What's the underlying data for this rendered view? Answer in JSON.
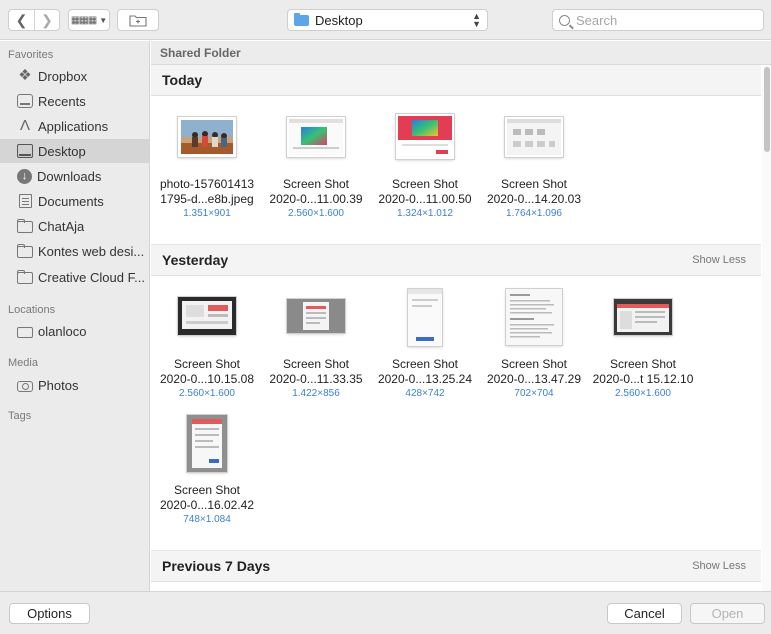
{
  "toolbar": {
    "back_icon": "chevron-left",
    "forward_icon": "chevron-right",
    "view_icon": "icon-grid",
    "location": "Desktop",
    "search_placeholder": "Search"
  },
  "sidebar": {
    "favorites_label": "Favorites",
    "favorites": [
      {
        "label": "Dropbox",
        "icon": "dropbox-icon"
      },
      {
        "label": "Recents",
        "icon": "recents-icon"
      },
      {
        "label": "Applications",
        "icon": "applications-icon"
      },
      {
        "label": "Desktop",
        "icon": "desktop-icon",
        "selected": true
      },
      {
        "label": "Downloads",
        "icon": "downloads-icon"
      },
      {
        "label": "Documents",
        "icon": "documents-icon"
      },
      {
        "label": "ChatAja",
        "icon": "folder-icon"
      },
      {
        "label": "Kontes web desi...",
        "icon": "folder-icon"
      },
      {
        "label": "Creative Cloud F...",
        "icon": "folder-icon"
      }
    ],
    "locations_label": "Locations",
    "locations": [
      {
        "label": "olanloco",
        "icon": "disk-icon"
      }
    ],
    "media_label": "Media",
    "media": [
      {
        "label": "Photos",
        "icon": "camera-icon"
      }
    ],
    "tags_label": "Tags"
  },
  "main": {
    "path_label": "Shared Folder",
    "groups": [
      {
        "title": "Today",
        "toggle": "",
        "files": [
          {
            "name1": "photo-157601413",
            "name2": "1795-d...e8b.jpeg",
            "dims": "1.351×901"
          },
          {
            "name1": "Screen Shot",
            "name2": "2020-0...11.00.39",
            "dims": "2.560×1.600"
          },
          {
            "name1": "Screen Shot",
            "name2": "2020-0...11.00.50",
            "dims": "1.324×1.012"
          },
          {
            "name1": "Screen Shot",
            "name2": "2020-0...14.20.03",
            "dims": "1.764×1.096"
          }
        ]
      },
      {
        "title": "Yesterday",
        "toggle": "Show Less",
        "files": [
          {
            "name1": "Screen Shot",
            "name2": "2020-0...10.15.08",
            "dims": "2.560×1.600"
          },
          {
            "name1": "Screen Shot",
            "name2": "2020-0...11.33.35",
            "dims": "1.422×856"
          },
          {
            "name1": "Screen Shot",
            "name2": "2020-0...13.25.24",
            "dims": "428×742"
          },
          {
            "name1": "Screen Shot",
            "name2": "2020-0...13.47.29",
            "dims": "702×704"
          },
          {
            "name1": "Screen Shot",
            "name2": "2020-0...t 15.12.10",
            "dims": "2.560×1.600"
          },
          {
            "name1": "Screen Shot",
            "name2": "2020-0...16.02.42",
            "dims": "748×1.084"
          }
        ]
      },
      {
        "title": "Previous 7 Days",
        "toggle": "Show Less",
        "files": []
      }
    ]
  },
  "footer": {
    "options_label": "Options",
    "cancel_label": "Cancel",
    "open_label": "Open"
  }
}
